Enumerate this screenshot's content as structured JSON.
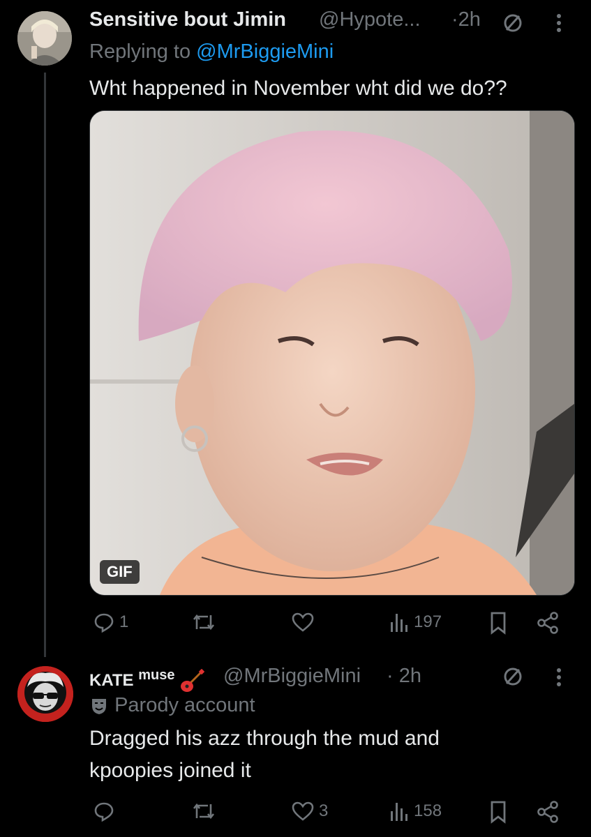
{
  "tweet1": {
    "display_name": "Sensitive bout Jimin",
    "handle": "@Hypote...",
    "time": "·2h",
    "replying_prefix": "Replying to",
    "replying_to": "@MrBiggieMini",
    "text": "Wht happened in November wht did we do??",
    "media_badge": "GIF",
    "actions": {
      "replies": "1",
      "reposts": "",
      "likes": "",
      "views": "197"
    }
  },
  "tweet2": {
    "display_name": "KATE",
    "display_name_suffix": "muse",
    "handle": "@MrBiggieMini",
    "time": "· 2h",
    "label": "Parody account",
    "text_line1": "Dragged his azz through the mud and",
    "text_line2": "kpoopies joined it",
    "actions": {
      "replies": "",
      "reposts": "",
      "likes": "3",
      "views": "158"
    }
  },
  "colors": {
    "background": "#000000",
    "text": "#e7e9ea",
    "muted": "#71767b",
    "link": "#1d9bf0",
    "avatar2_bg": "#c4221e"
  },
  "icons": [
    "no-sign-icon",
    "more-vertical-icon",
    "reply-icon",
    "repost-icon",
    "like-icon",
    "views-icon",
    "bookmark-icon",
    "share-icon",
    "guitar-emoji-icon",
    "parody-mask-icon"
  ]
}
